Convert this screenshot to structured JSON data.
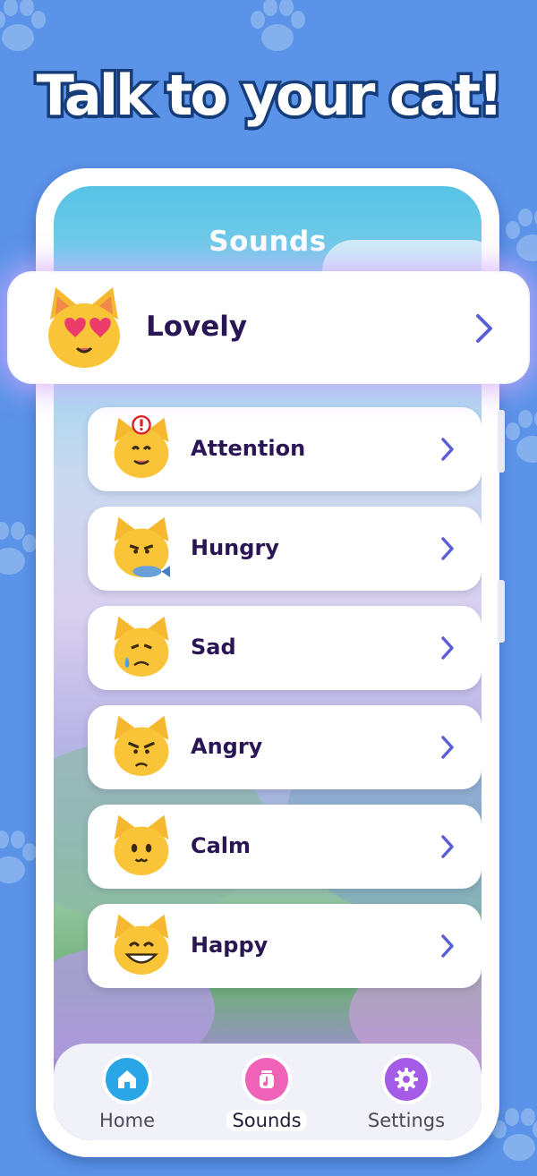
{
  "headline": "Talk to your cat!",
  "screen": {
    "title": "Sounds"
  },
  "featured": {
    "label": "Lovely",
    "icon": "heart-eyes-cat-icon"
  },
  "sounds": [
    {
      "label": "Attention",
      "icon": "attention-cat-icon"
    },
    {
      "label": "Hungry",
      "icon": "hungry-cat-icon"
    },
    {
      "label": "Sad",
      "icon": "sad-cat-icon"
    },
    {
      "label": "Angry",
      "icon": "angry-cat-icon"
    },
    {
      "label": "Calm",
      "icon": "calm-cat-icon"
    },
    {
      "label": "Happy",
      "icon": "happy-cat-icon"
    }
  ],
  "nav": {
    "items": [
      {
        "label": "Home",
        "icon": "home-icon",
        "color": "#2aa6e6"
      },
      {
        "label": "Sounds",
        "icon": "music-album-icon",
        "color": "#f061b8",
        "active": true
      },
      {
        "label": "Settings",
        "icon": "gear-icon",
        "color": "#a45be6"
      }
    ]
  },
  "colors": {
    "background": "#5b93e8",
    "label_text": "#2a1655",
    "chevron": "#5b5fd6"
  }
}
